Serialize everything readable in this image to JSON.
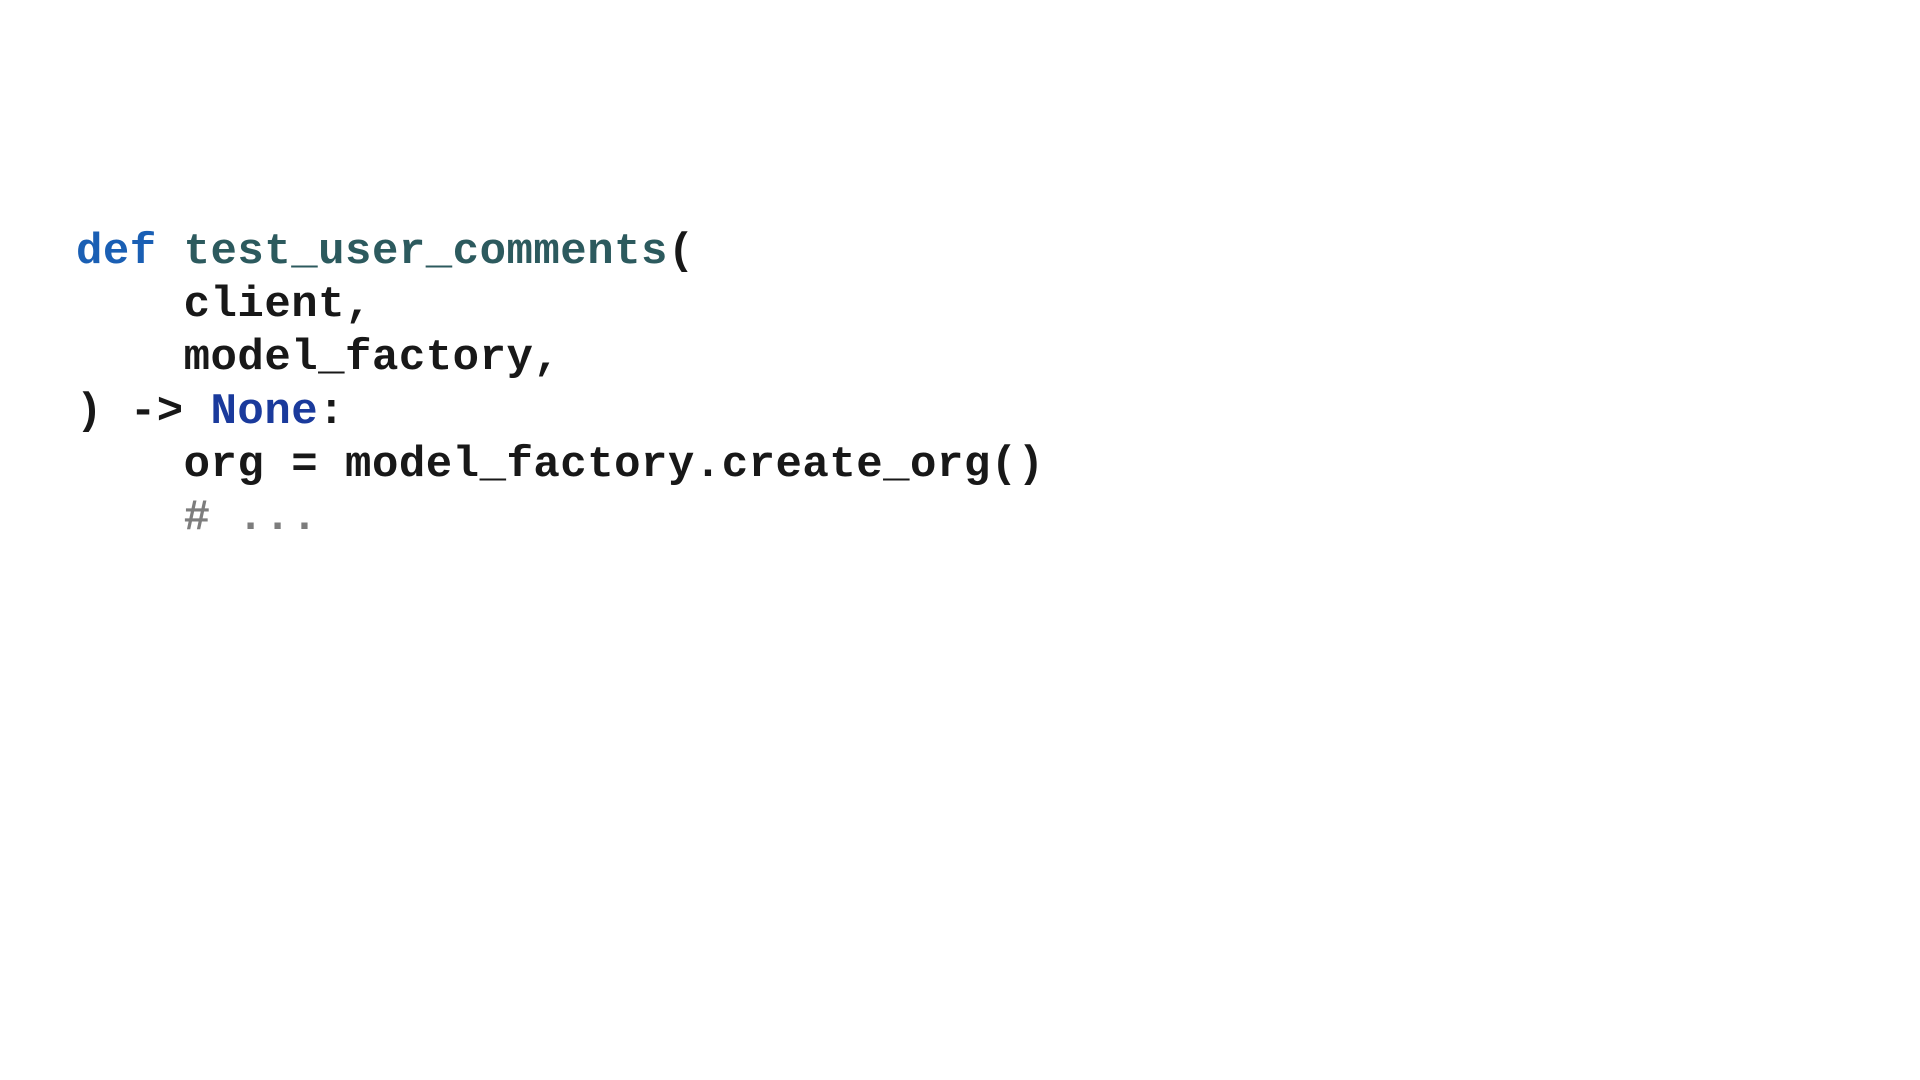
{
  "code": {
    "line1": {
      "def": "def",
      "space1": " ",
      "fname": "test_user_comments",
      "paren": "("
    },
    "line2": {
      "indent": "    ",
      "text": "client,"
    },
    "line3": {
      "indent": "    ",
      "text": "model_factory,"
    },
    "line4": {
      "paren": ") ",
      "arrow": "-> ",
      "none": "None",
      "colon": ":"
    },
    "line5": {
      "indent": "    ",
      "text": "org = model_factory.create_org()"
    },
    "line6": {
      "indent": "    ",
      "comment": "# ..."
    }
  }
}
